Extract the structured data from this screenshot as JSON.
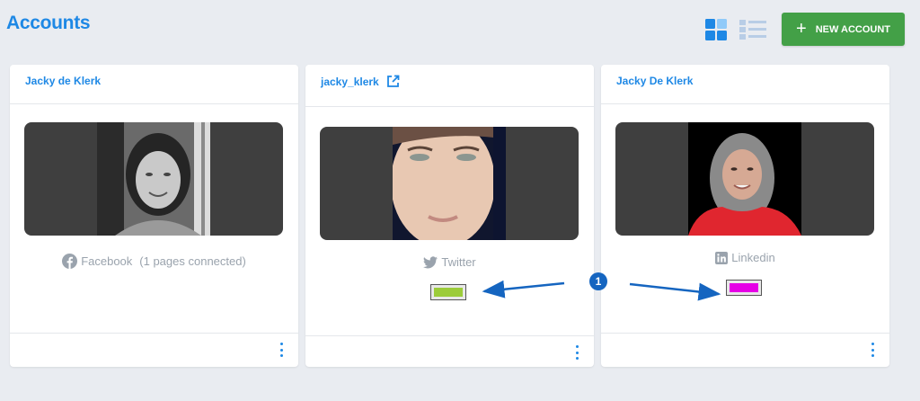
{
  "page": {
    "title": "Accounts"
  },
  "toolbar": {
    "new_account_label": "NEW ACCOUNT",
    "accent_color": "#1e88e5",
    "button_color": "#43a047",
    "views": [
      "grid-view-icon",
      "list-view-icon"
    ],
    "active_view": "grid"
  },
  "cards": [
    {
      "name": "Jacky de Klerk",
      "network": "Facebook",
      "network_detail": "(1 pages connected)",
      "network_icon": "facebook-icon"
    },
    {
      "name": "jacky_klerk",
      "network": "Twitter",
      "network_icon": "twitter-icon",
      "external_link_icon": "external-link-icon",
      "swatch_color": "#9ccc3a"
    },
    {
      "name": "Jacky De Klerk",
      "network": "Linkedin",
      "network_icon": "linkedin-icon",
      "swatch_color": "#e600e6"
    }
  ],
  "annotation": {
    "badge": "1",
    "color": "#1565c0"
  }
}
